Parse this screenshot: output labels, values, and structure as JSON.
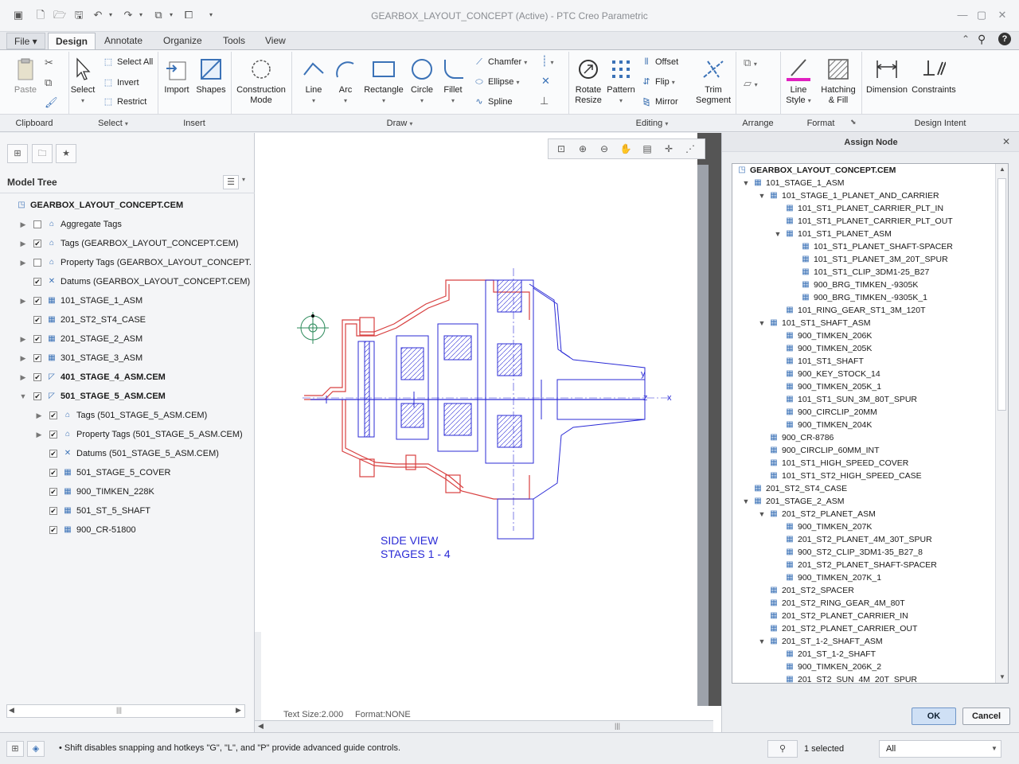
{
  "window": {
    "title": "GEARBOX_LAYOUT_CONCEPT (Active) - PTC Creo Parametric"
  },
  "tabs": [
    {
      "label": "File ▾"
    },
    {
      "label": "Design"
    },
    {
      "label": "Annotate"
    },
    {
      "label": "Organize"
    },
    {
      "label": "Tools"
    },
    {
      "label": "View"
    }
  ],
  "ribbon": {
    "clipboard": {
      "paste": "Paste",
      "group": "Clipboard"
    },
    "select": {
      "select": "Select",
      "select_all": "Select All",
      "invert": "Invert",
      "restrict": "Restrict",
      "group": "Select"
    },
    "insert": {
      "import": "Import",
      "shapes": "Shapes",
      "group": "Insert"
    },
    "construction": {
      "label1": "Construction",
      "label2": "Mode"
    },
    "draw": {
      "line": "Line",
      "arc": "Arc",
      "rectangle": "Rectangle",
      "circle": "Circle",
      "fillet": "Fillet",
      "chamfer": "Chamfer",
      "ellipse": "Ellipse",
      "spline": "Spline",
      "group": "Draw"
    },
    "editing": {
      "rotate1": "Rotate",
      "rotate2": "Resize",
      "pattern": "Pattern",
      "offset": "Offset",
      "flip": "Flip",
      "mirror": "Mirror",
      "trim1": "Trim",
      "trim2": "Segment",
      "group": "Editing"
    },
    "arrange": {
      "group": "Arrange"
    },
    "format": {
      "line1": "Line",
      "line2": "Style",
      "hatch1": "Hatching",
      "hatch2": "& Fill",
      "group": "Format"
    },
    "intent": {
      "dimension": "Dimension",
      "constraints": "Constraints",
      "group": "Design Intent"
    }
  },
  "model_tree": {
    "title": "Model Tree",
    "items": [
      {
        "label": "GEARBOX_LAYOUT_CONCEPT.CEM",
        "level": 0,
        "toggle": "",
        "check": "none",
        "icon": "◳",
        "bold": false
      },
      {
        "label": "Aggregate Tags",
        "level": 1,
        "toggle": "▶",
        "check": "off",
        "icon": "⌂",
        "bold": false
      },
      {
        "label": "Tags (GEARBOX_LAYOUT_CONCEPT.CEM)",
        "level": 1,
        "toggle": "▶",
        "check": "on",
        "icon": "⌂",
        "bold": false
      },
      {
        "label": "Property Tags (GEARBOX_LAYOUT_CONCEPT.",
        "level": 1,
        "toggle": "▶",
        "check": "off",
        "icon": "⌂",
        "bold": false
      },
      {
        "label": "Datums (GEARBOX_LAYOUT_CONCEPT.CEM)",
        "level": 1,
        "toggle": "",
        "check": "on",
        "icon": "✕",
        "bold": false
      },
      {
        "label": "101_STAGE_1_ASM",
        "level": 1,
        "toggle": "▶",
        "check": "on",
        "icon": "▦",
        "bold": false
      },
      {
        "label": "201_ST2_ST4_CASE",
        "level": 1,
        "toggle": "",
        "check": "on",
        "icon": "▦",
        "bold": false
      },
      {
        "label": "201_STAGE_2_ASM",
        "level": 1,
        "toggle": "▶",
        "check": "on",
        "icon": "▦",
        "bold": false
      },
      {
        "label": "301_STAGE_3_ASM",
        "level": 1,
        "toggle": "▶",
        "check": "on",
        "icon": "▦",
        "bold": false
      },
      {
        "label": "401_STAGE_4_ASM.CEM",
        "level": 1,
        "toggle": "▶",
        "check": "on",
        "icon": "◸",
        "bold": true
      },
      {
        "label": "501_STAGE_5_ASM.CEM",
        "level": 1,
        "toggle": "▼",
        "check": "on",
        "icon": "◸",
        "bold": true
      },
      {
        "label": "Tags (501_STAGE_5_ASM.CEM)",
        "level": 2,
        "toggle": "▶",
        "check": "on",
        "icon": "⌂",
        "bold": false
      },
      {
        "label": "Property Tags (501_STAGE_5_ASM.CEM)",
        "level": 2,
        "toggle": "▶",
        "check": "on",
        "icon": "⌂",
        "bold": false
      },
      {
        "label": "Datums (501_STAGE_5_ASM.CEM)",
        "level": 2,
        "toggle": "",
        "check": "on",
        "icon": "✕",
        "bold": false
      },
      {
        "label": "501_STAGE_5_COVER",
        "level": 2,
        "toggle": "",
        "check": "on",
        "icon": "▦",
        "bold": false
      },
      {
        "label": "900_TIMKEN_228K",
        "level": 2,
        "toggle": "",
        "check": "on",
        "icon": "▦",
        "bold": false
      },
      {
        "label": "501_ST_5_SHAFT",
        "level": 2,
        "toggle": "",
        "check": "on",
        "icon": "▦",
        "bold": false
      },
      {
        "label": "900_CR-51800",
        "level": 2,
        "toggle": "",
        "check": "on",
        "icon": "▦",
        "bold": false
      }
    ]
  },
  "canvas": {
    "label1": "SIDE VIEW",
    "label2": "STAGES 1 - 4",
    "text_size": "Text Size:2.000",
    "format": "Format:NONE",
    "axis_y": "y",
    "axis_z": "z",
    "axis_x": "x"
  },
  "dialog": {
    "title": "Assign Node",
    "ok": "OK",
    "cancel": "Cancel",
    "nodes": [
      {
        "label": "GEARBOX_LAYOUT_CONCEPT.CEM",
        "level": 0,
        "toggle": ""
      },
      {
        "label": "101_STAGE_1_ASM",
        "level": 1,
        "toggle": "▼"
      },
      {
        "label": "101_STAGE_1_PLANET_AND_CARRIER",
        "level": 2,
        "toggle": "▼"
      },
      {
        "label": "101_ST1_PLANET_CARRIER_PLT_IN",
        "level": 3,
        "toggle": ""
      },
      {
        "label": "101_ST1_PLANET_CARRIER_PLT_OUT",
        "level": 3,
        "toggle": ""
      },
      {
        "label": "101_ST1_PLANET_ASM",
        "level": 3,
        "toggle": "▼"
      },
      {
        "label": "101_ST1_PLANET_SHAFT-SPACER",
        "level": 4,
        "toggle": ""
      },
      {
        "label": "101_ST1_PLANET_3M_20T_SPUR",
        "level": 4,
        "toggle": ""
      },
      {
        "label": "101_ST1_CLIP_3DM1-25_B27",
        "level": 4,
        "toggle": ""
      },
      {
        "label": "900_BRG_TIMKEN_-9305K",
        "level": 4,
        "toggle": ""
      },
      {
        "label": "900_BRG_TIMKEN_-9305K_1",
        "level": 4,
        "toggle": ""
      },
      {
        "label": "101_RING_GEAR_ST1_3M_120T",
        "level": 3,
        "toggle": ""
      },
      {
        "label": "101_ST1_SHAFT_ASM",
        "level": 2,
        "toggle": "▼"
      },
      {
        "label": "900_TIMKEN_206K",
        "level": 3,
        "toggle": ""
      },
      {
        "label": "900_TIMKEN_205K",
        "level": 3,
        "toggle": ""
      },
      {
        "label": "101_ST1_SHAFT",
        "level": 3,
        "toggle": ""
      },
      {
        "label": "900_KEY_STOCK_14",
        "level": 3,
        "toggle": ""
      },
      {
        "label": "900_TIMKEN_205K_1",
        "level": 3,
        "toggle": ""
      },
      {
        "label": "101_ST1_SUN_3M_80T_SPUR",
        "level": 3,
        "toggle": ""
      },
      {
        "label": "900_CIRCLIP_20MM",
        "level": 3,
        "toggle": ""
      },
      {
        "label": "900_TIMKEN_204K",
        "level": 3,
        "toggle": ""
      },
      {
        "label": "900_CR-8786",
        "level": 2,
        "toggle": ""
      },
      {
        "label": "900_CIRCLIP_60MM_INT",
        "level": 2,
        "toggle": ""
      },
      {
        "label": "101_ST1_HIGH_SPEED_COVER",
        "level": 2,
        "toggle": ""
      },
      {
        "label": "101_ST1_ST2_HIGH_SPEED_CASE",
        "level": 2,
        "toggle": ""
      },
      {
        "label": "201_ST2_ST4_CASE",
        "level": 1,
        "toggle": ""
      },
      {
        "label": "201_STAGE_2_ASM",
        "level": 1,
        "toggle": "▼"
      },
      {
        "label": "201_ST2_PLANET_ASM",
        "level": 2,
        "toggle": "▼"
      },
      {
        "label": "900_TIMKEN_207K",
        "level": 3,
        "toggle": ""
      },
      {
        "label": "201_ST2_PLANET_4M_30T_SPUR",
        "level": 3,
        "toggle": ""
      },
      {
        "label": "900_ST2_CLIP_3DM1-35_B27_8",
        "level": 3,
        "toggle": ""
      },
      {
        "label": "201_ST2_PLANET_SHAFT-SPACER",
        "level": 3,
        "toggle": ""
      },
      {
        "label": "900_TIMKEN_207K_1",
        "level": 3,
        "toggle": ""
      },
      {
        "label": "201_ST2_SPACER",
        "level": 2,
        "toggle": ""
      },
      {
        "label": "201_ST2_RING_GEAR_4M_80T",
        "level": 2,
        "toggle": ""
      },
      {
        "label": "201_ST2_PLANET_CARRIER_IN",
        "level": 2,
        "toggle": ""
      },
      {
        "label": "201_ST2_PLANET_CARRIER_OUT",
        "level": 2,
        "toggle": ""
      },
      {
        "label": "201_ST_1-2_SHAFT_ASM",
        "level": 2,
        "toggle": "▼"
      },
      {
        "label": "201_ST_1-2_SHAFT",
        "level": 3,
        "toggle": ""
      },
      {
        "label": "900_TIMKEN_206K_2",
        "level": 3,
        "toggle": ""
      },
      {
        "label": "201_ST2_SUN_4M_20T_SPUR",
        "level": 3,
        "toggle": ""
      }
    ]
  },
  "status": {
    "message": "• Shift disables snapping and hotkeys \"G\", \"L\", and \"P\" provide advanced guide controls.",
    "selected": "1 selected",
    "filter": "All"
  },
  "colors": {
    "accent": "#3b72b7",
    "drawing_blue": "#2b2bd6",
    "drawing_red": "#d84040",
    "line_style": "#e020c0"
  }
}
